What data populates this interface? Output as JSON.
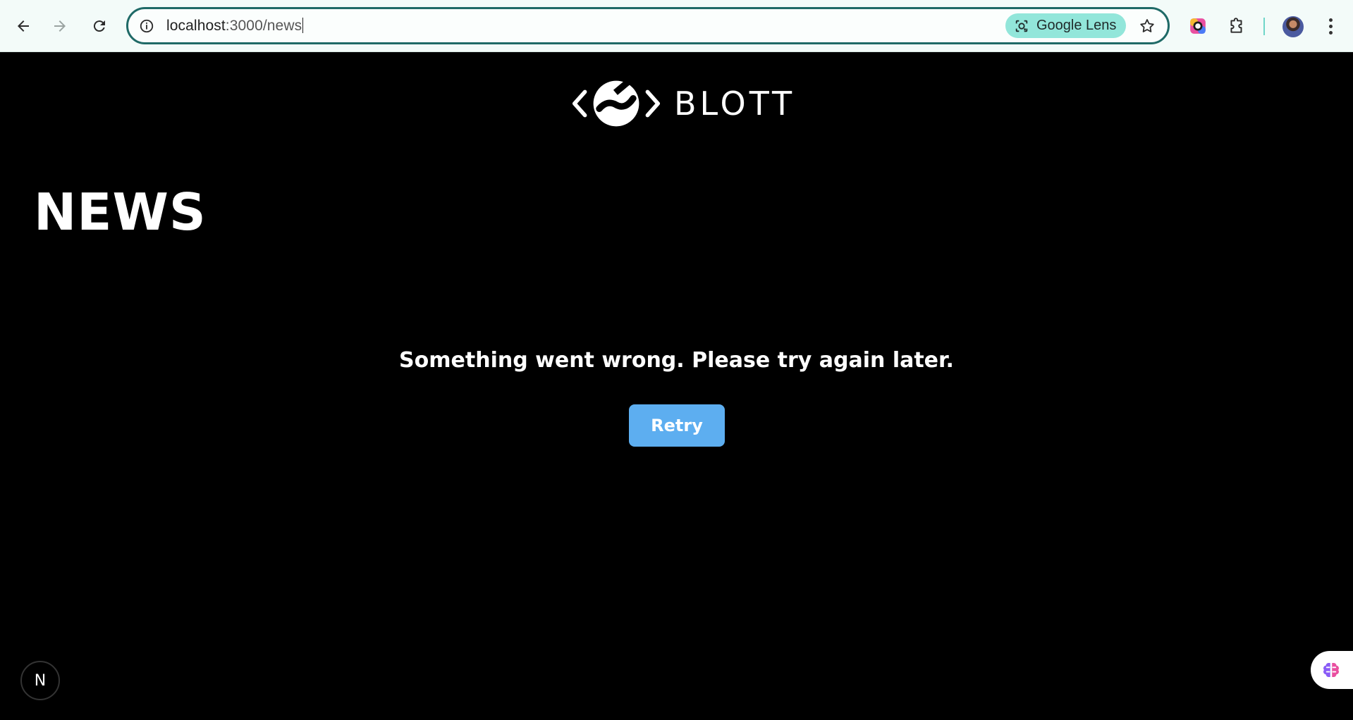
{
  "browser": {
    "url_host": "localhost",
    "url_path": ":3000/news",
    "lens_label": "Google Lens"
  },
  "brand": {
    "wordmark": "BLOTT"
  },
  "page": {
    "title": "NEWS",
    "error_message": "Something went wrong. Please try again later.",
    "retry_label": "Retry"
  },
  "dev_badge": {
    "letter": "N"
  },
  "colors": {
    "page_background": "#000000",
    "retry_button": "#5daef0",
    "omnibox_border": "#1f6a67",
    "lens_chip": "#92e6da"
  },
  "icons": [
    "back-icon",
    "forward-icon",
    "reload-icon",
    "site-info-icon",
    "google-lens-icon",
    "bookmark-star-icon",
    "extension-color-icon",
    "extensions-puzzle-icon",
    "profile-avatar",
    "chrome-menu-icon",
    "blott-logo-icon",
    "nextjs-dev-icon",
    "ai-brain-icon"
  ]
}
